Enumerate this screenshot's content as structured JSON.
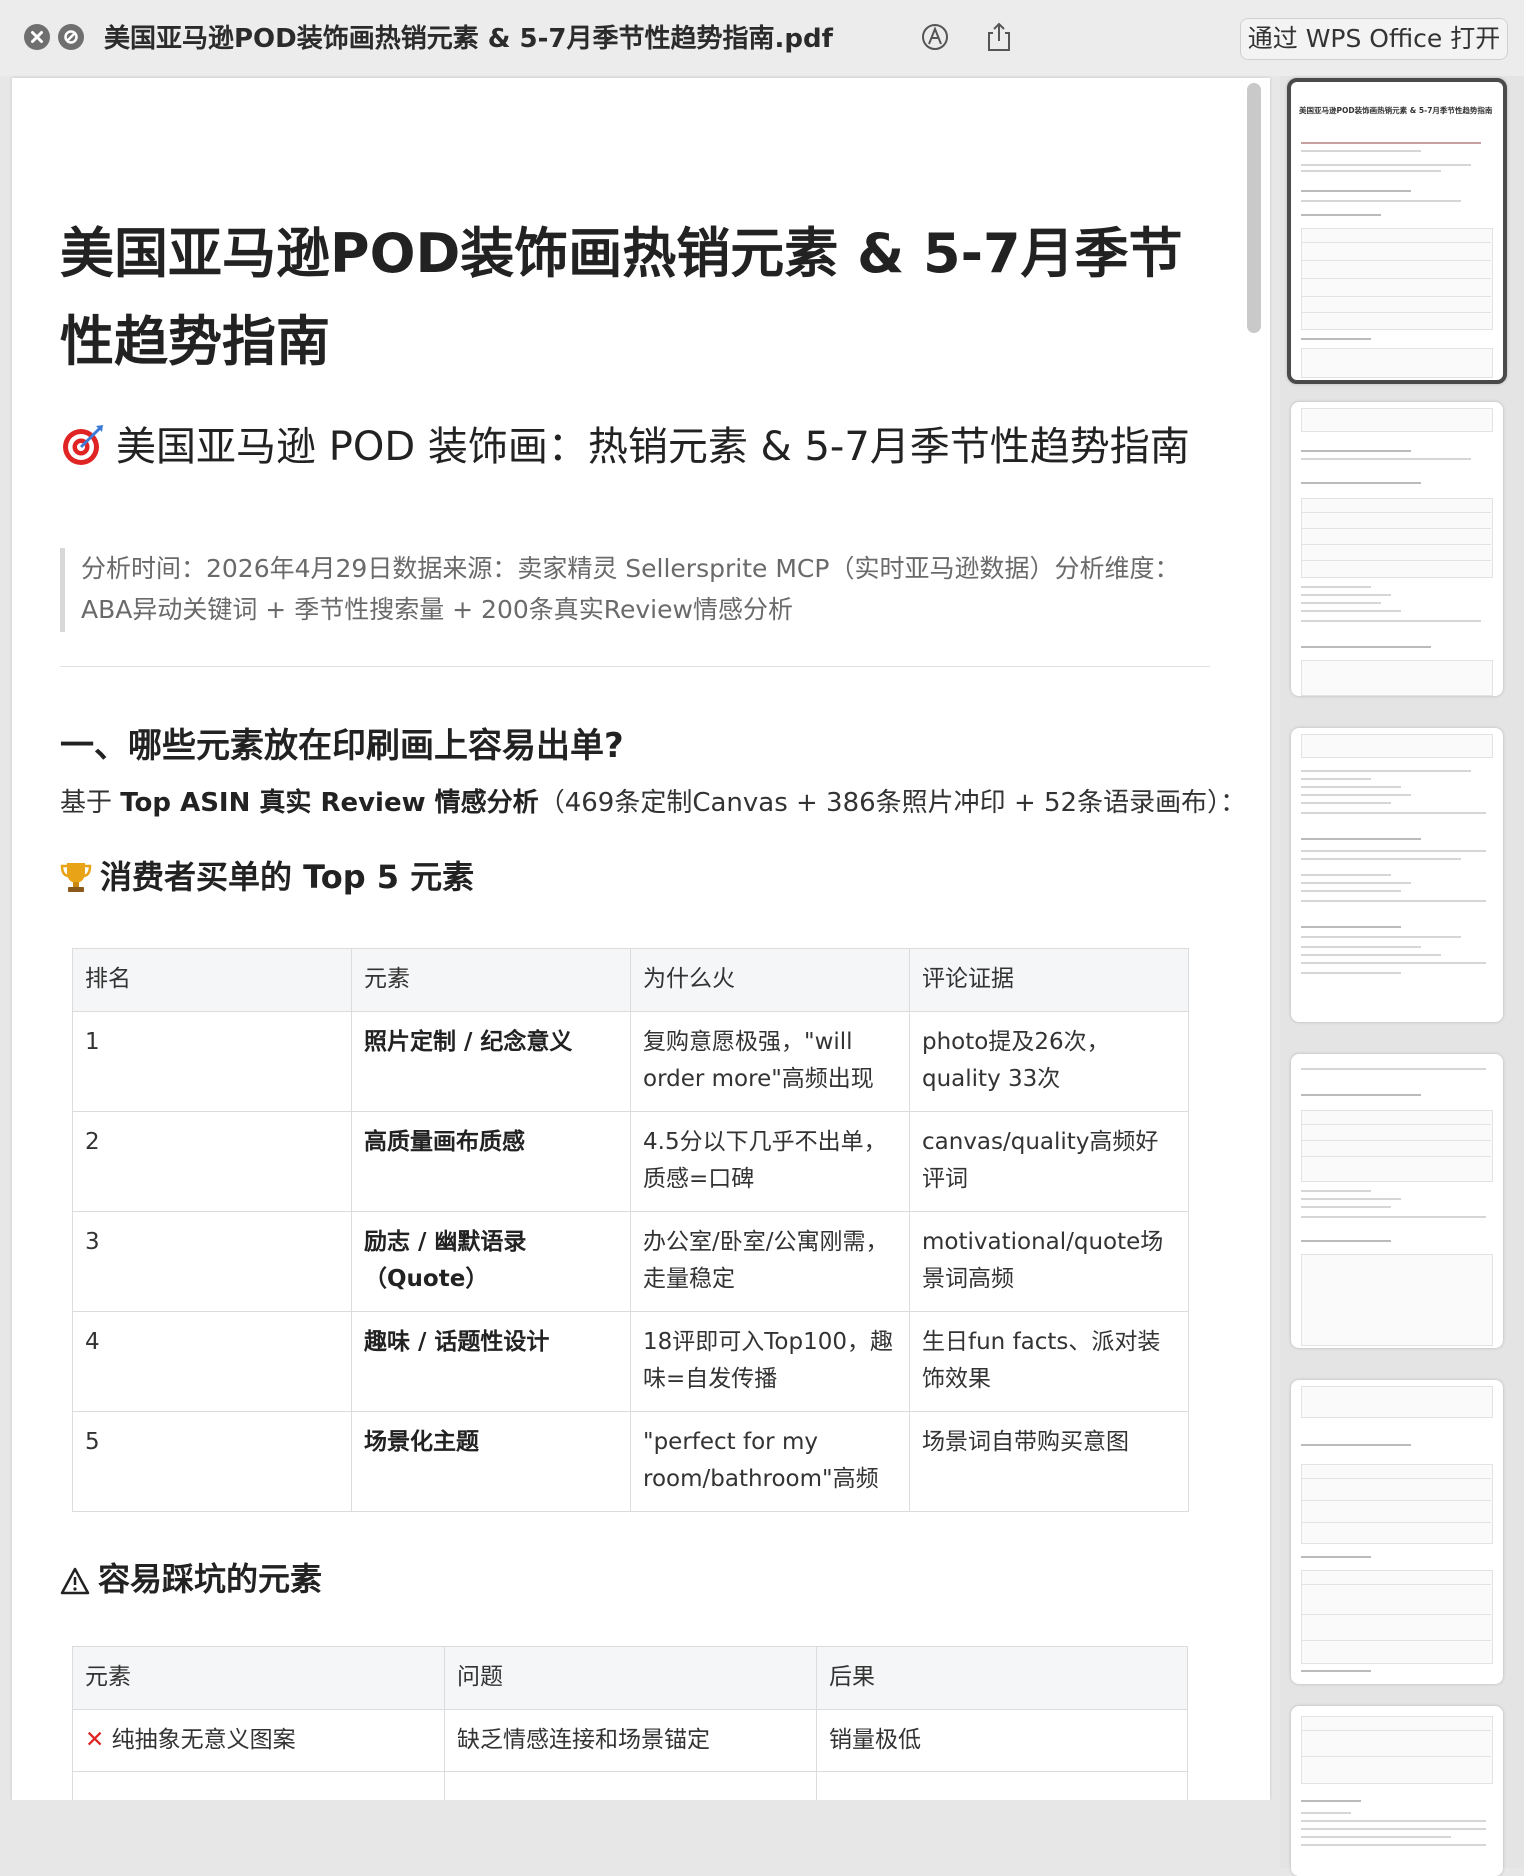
{
  "titlebar": {
    "doc_title": "美国亚马逊POD装饰画热销元素 & 5-7月季节性趋势指南.pdf",
    "open_with_label": "通过 WPS Office 打开"
  },
  "doc": {
    "title": "美国亚马逊POD装饰画热销元素 & 5-7月季节性趋势指南",
    "subtitle": "美国亚马逊 POD 装饰画：热销元素 & 5-7月季节性趋势指南",
    "quote": "分析时间：2026年4月29日数据来源：卖家精灵 Sellersprite MCP（实时亚马逊数据）分析维度：ABA异动关键词 + 季节性搜索量 + 200条真实Review情感分析",
    "section1_title": "一、哪些元素放在印刷画上容易出单?",
    "section1_para_prefix": "基于 ",
    "section1_para_bold": "Top ASIN 真实 Review 情感分析",
    "section1_para_suffix": "（469条定制Canvas + 386条照片冲印 + 52条语录画布）：",
    "top5_title": "消费者买单的 Top 5 元素",
    "top5_headers": [
      "排名",
      "元素",
      "为什么火",
      "评论证据"
    ],
    "top5_rows": [
      {
        "rank": "1",
        "element": "照片定制 / 纪念意义",
        "why": "复购意愿极强，\"will order more\"高频出现",
        "evidence": "photo提及26次，quality 33次"
      },
      {
        "rank": "2",
        "element": "高质量画布质感",
        "why": "4.5分以下几乎不出单，质感=口碑",
        "evidence": "canvas/quality高频好评词"
      },
      {
        "rank": "3",
        "element": "励志 / 幽默语录（Quote）",
        "why": "办公室/卧室/公寓刚需，走量稳定",
        "evidence": "motivational/quote场景词高频"
      },
      {
        "rank": "4",
        "element": "趣味 / 话题性设计",
        "why": "18评即可入Top100，趣味=自发传播",
        "evidence": "生日fun facts、派对装饰效果"
      },
      {
        "rank": "5",
        "element": "场景化主题",
        "why": "\"perfect for my room/bathroom\"高频",
        "evidence": "场景词自带购买意图"
      }
    ],
    "pitfall_title": "容易踩坑的元素",
    "pitfall_headers": [
      "元素",
      "问题",
      "后果"
    ],
    "pitfall_rows": [
      {
        "element": "纯抽象无意义图案",
        "problem": "缺乏情感连接和场景锚定",
        "result": "销量极低"
      }
    ]
  },
  "thumbnails": [
    {
      "label": "美国亚马逊POD装饰画热销元素 & 5-7月季节性趋势指南"
    }
  ],
  "colors": {
    "accent_red": "#e02424",
    "trophy": "#e8a317"
  }
}
